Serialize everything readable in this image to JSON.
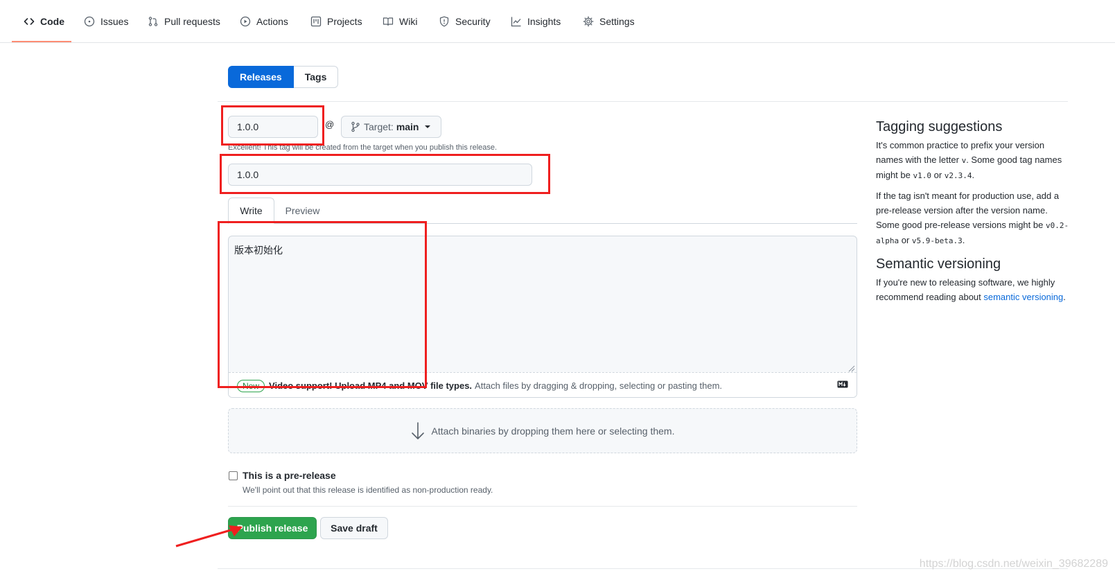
{
  "nav": {
    "items": [
      {
        "label": "Code",
        "icon": "code-icon"
      },
      {
        "label": "Issues",
        "icon": "issue-icon"
      },
      {
        "label": "Pull requests",
        "icon": "pull-request-icon"
      },
      {
        "label": "Actions",
        "icon": "play-icon"
      },
      {
        "label": "Projects",
        "icon": "project-icon"
      },
      {
        "label": "Wiki",
        "icon": "book-icon"
      },
      {
        "label": "Security",
        "icon": "shield-icon"
      },
      {
        "label": "Insights",
        "icon": "graph-icon"
      },
      {
        "label": "Settings",
        "icon": "gear-icon"
      }
    ],
    "active": "Code"
  },
  "subnav": {
    "releases": "Releases",
    "tags": "Tags"
  },
  "form": {
    "tag_value": "1.0.0",
    "at": "@",
    "target_label": "Target:",
    "target_branch": "main",
    "tag_note": "Excellent! This tag will be created from the target when you publish this release.",
    "title_value": "1.0.0",
    "tabs": {
      "write": "Write",
      "preview": "Preview"
    },
    "body_text": "版本初始化",
    "footer": {
      "badge": "New",
      "strong": "Video support! Upload MP4 and MOV file types.",
      "text": "Attach files by dragging & dropping, selecting or pasting them."
    },
    "dropzone": "Attach binaries by dropping them here or selecting them.",
    "prerelease_label": "This is a pre-release",
    "prerelease_note": "We'll point out that this release is identified as non-production ready.",
    "publish": "Publish release",
    "save_draft": "Save draft"
  },
  "sidebar": {
    "tagging_title": "Tagging suggestions",
    "tagging_p1_a": "It's common practice to prefix your version names with the letter ",
    "tagging_p1_v": "v",
    "tagging_p1_b": ". Some good tag names might be ",
    "tagging_p1_c1": "v1.0",
    "tagging_p1_or": " or ",
    "tagging_p1_c2": "v2.3.4",
    "tagging_p1_end": ".",
    "tagging_p2_a": "If the tag isn't meant for production use, add a pre-release version after the version name. Some good pre-release versions might be ",
    "tagging_p2_c1": "v0.2-alpha",
    "tagging_p2_or": " or ",
    "tagging_p2_c2": "v5.9-beta.3",
    "tagging_p2_end": ".",
    "semver_title": "Semantic versioning",
    "semver_p_a": "If you're new to releasing software, we highly recommend reading about ",
    "semver_link": "semantic versioning",
    "semver_p_end": "."
  },
  "watermark": "https://blog.csdn.net/weixin_39682289",
  "colors": {
    "accent": "#0969da",
    "primary_button": "#2da44e",
    "annotation": "#ef1f1f",
    "nav_underline": "#fd8c73"
  }
}
